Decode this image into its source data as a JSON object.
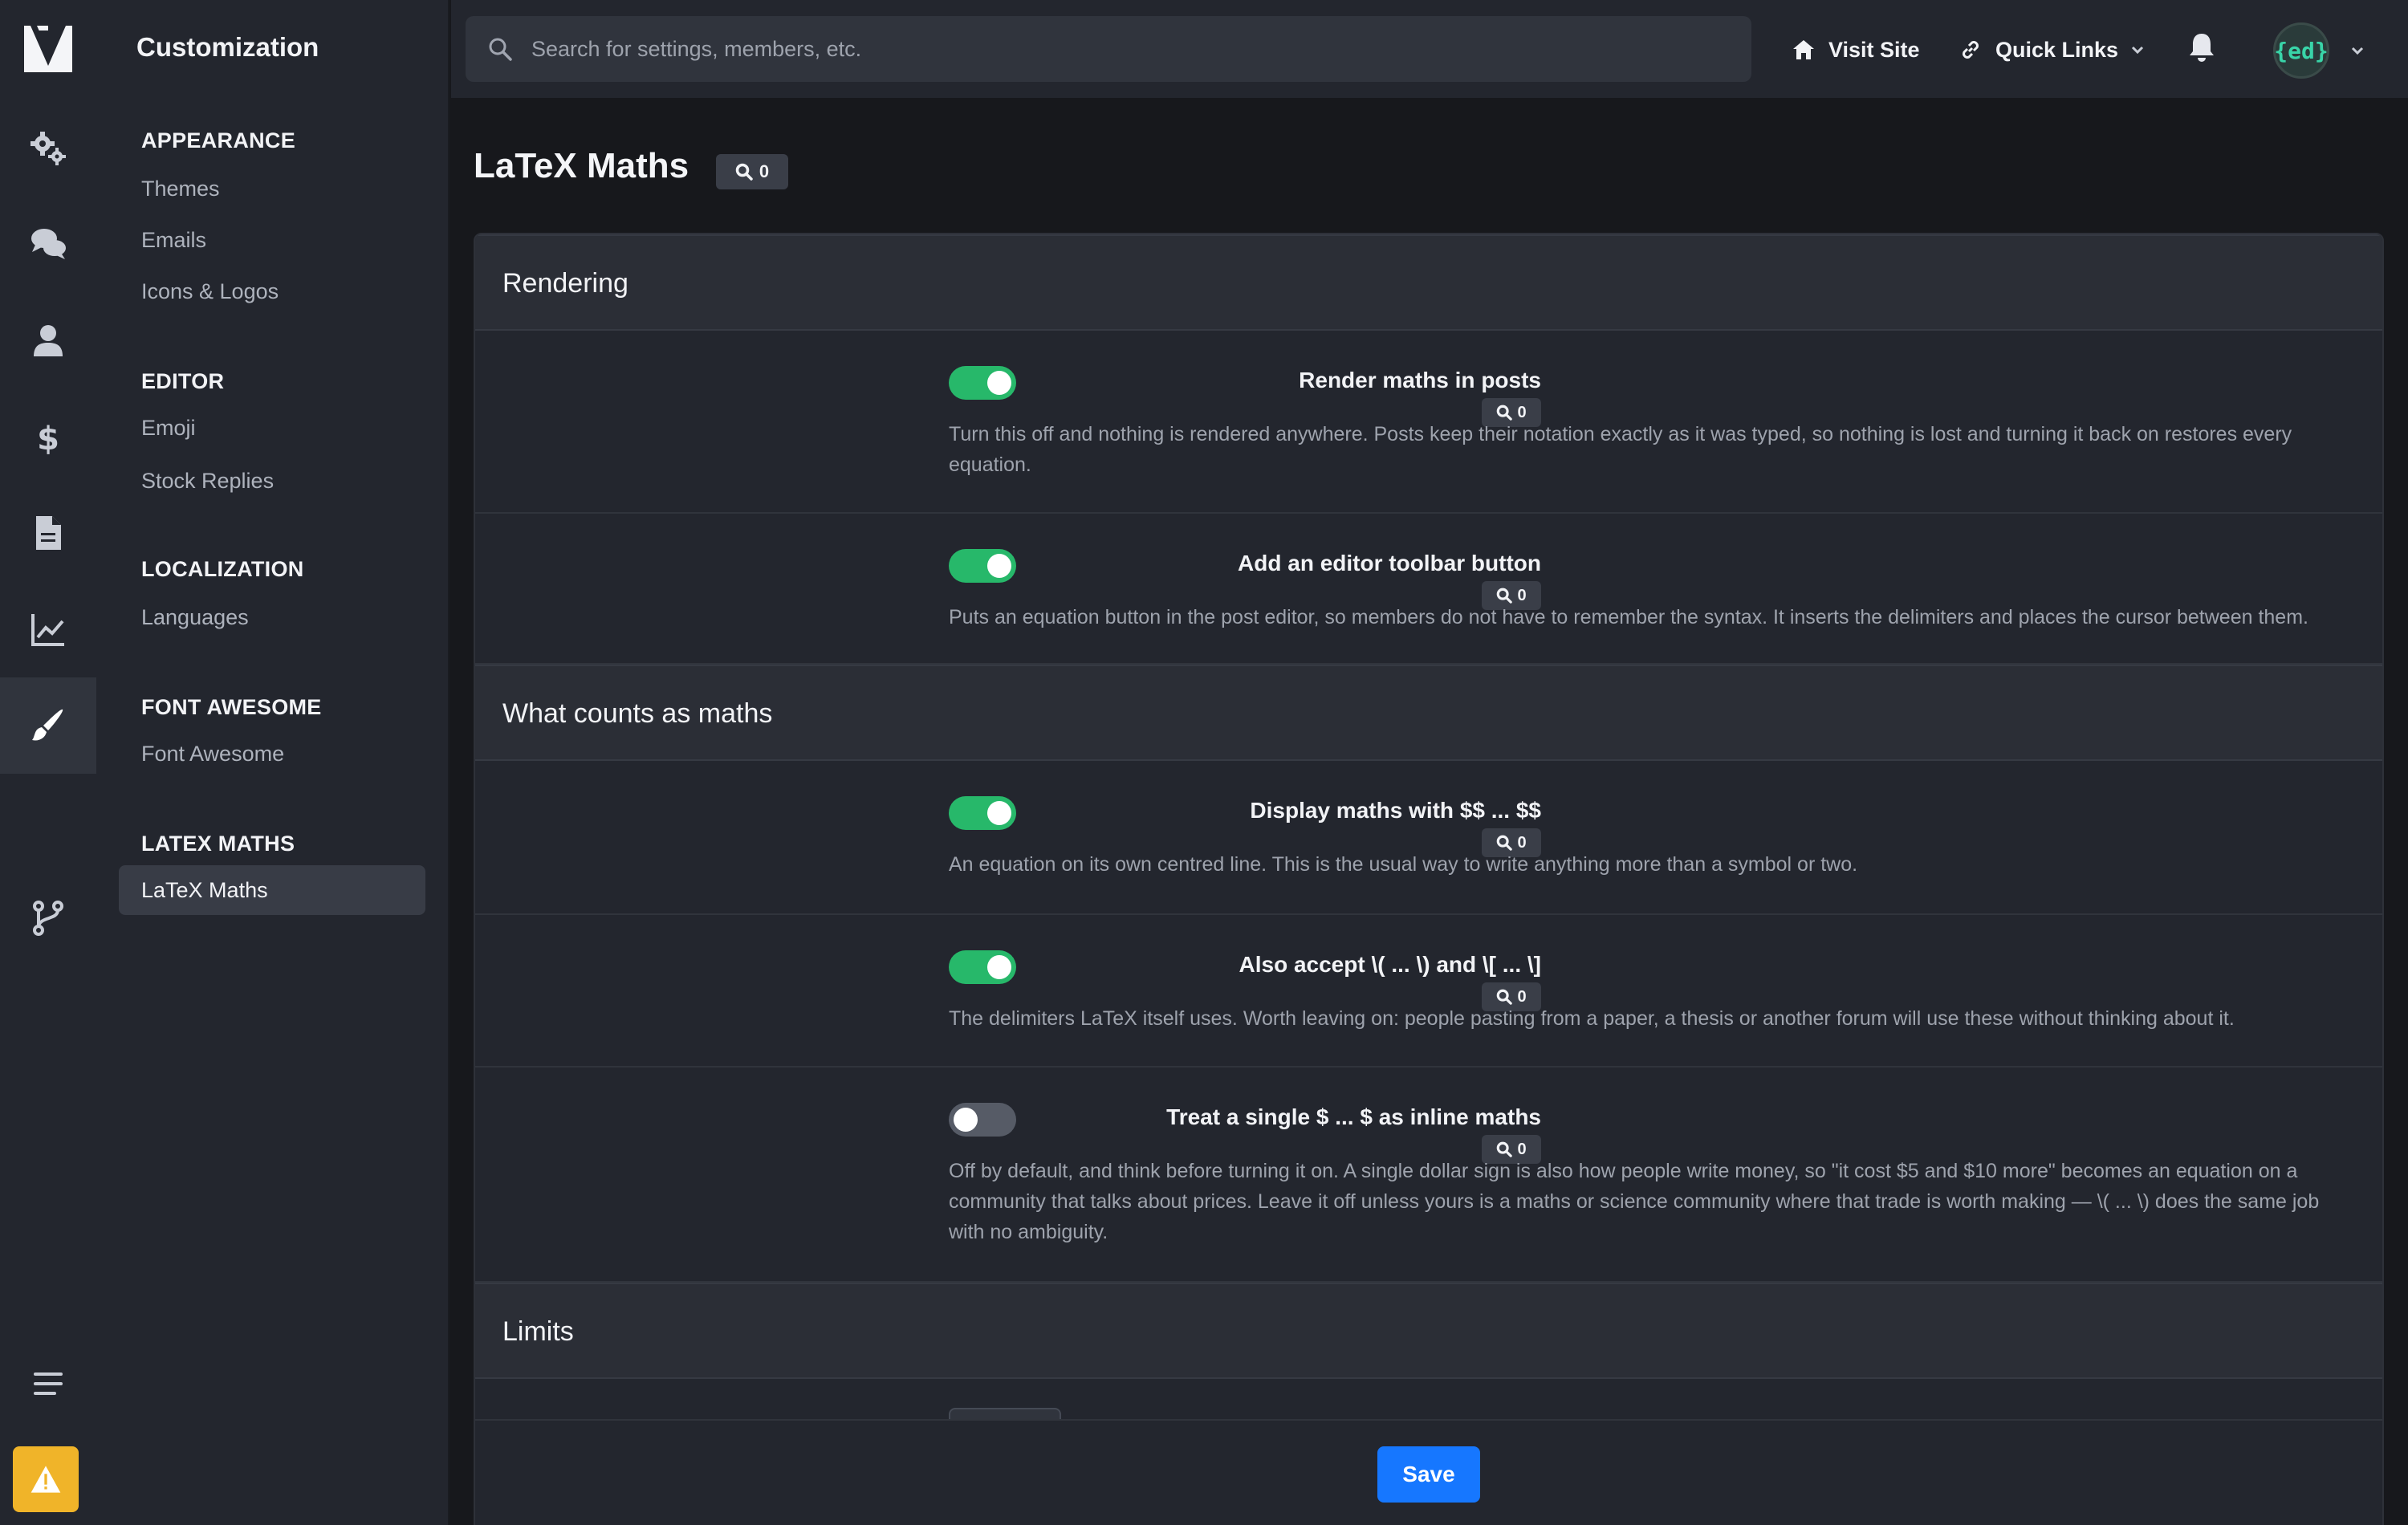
{
  "app": {
    "section_title": "Customization"
  },
  "rail": {
    "icons": [
      "logo-icon",
      "settings-gears-icon",
      "discussions-icon",
      "members-icon",
      "commerce-dollar-icon",
      "pages-document-icon",
      "statistics-chart-icon",
      "customization-brush-icon",
      "developer-branch-icon",
      "menu-icon",
      "warning-icon"
    ],
    "active": "customization-brush-icon",
    "warning_color": "#f0b429"
  },
  "subnav": {
    "groups": [
      {
        "title": "APPEARANCE",
        "items": [
          "Themes",
          "Emails",
          "Icons & Logos"
        ]
      },
      {
        "title": "EDITOR",
        "items": [
          "Emoji",
          "Stock Replies"
        ]
      },
      {
        "title": "LOCALIZATION",
        "items": [
          "Languages"
        ]
      },
      {
        "title": "FONT AWESOME",
        "items": [
          "Font Awesome"
        ]
      },
      {
        "title": "LATEX MATHS",
        "items": [
          "LaTeX Maths"
        ]
      }
    ],
    "active_item": "LaTeX Maths"
  },
  "topbar": {
    "search_placeholder": "Search for settings, members, etc.",
    "visit_site": "Visit Site",
    "quick_links": "Quick Links",
    "avatar_text": "{ed}"
  },
  "page": {
    "title": "LaTeX Maths",
    "search_count": "0"
  },
  "sections": [
    {
      "title": "Rendering",
      "rows": [
        {
          "label": "Render maths in posts",
          "count": "0",
          "enabled": true,
          "description": "Turn this off and nothing is rendered anywhere. Posts keep their notation exactly as it was typed, so nothing is lost and turning it back on restores every equation."
        },
        {
          "label": "Add an editor toolbar button",
          "count": "0",
          "enabled": true,
          "description": "Puts an equation button in the post editor, so members do not have to remember the syntax. It inserts the delimiters and places the cursor between them."
        }
      ]
    },
    {
      "title": "What counts as maths",
      "rows": [
        {
          "label": "Display maths with $$ ... $$",
          "count": "0",
          "enabled": true,
          "description": "An equation on its own centred line. This is the usual way to write anything more than a symbol or two."
        },
        {
          "label": "Also accept \\( ... \\) and \\[ ... \\]",
          "count": "0",
          "enabled": true,
          "description": "The delimiters LaTeX itself uses. Worth leaving on: people pasting from a paper, a thesis or another forum will use these without thinking about it."
        },
        {
          "label": "Treat a single $ ... $ as inline maths",
          "count": "0",
          "enabled": false,
          "description": "Off by default, and think before turning it on. A single dollar sign is also how people write money, so \"it cost $5 and $10 more\" becomes an equation on a community that talks about prices. Leave it off unless yours is a maths or science community where that trade is worth making — \\( ... \\) does the same job with no ambiguity."
        }
      ]
    },
    {
      "title": "Limits",
      "rows": []
    }
  ],
  "footer": {
    "save_label": "Save",
    "accent": "#1677ff"
  },
  "colors": {
    "toggle_on": "#27b86a",
    "toggle_off": "#565b66"
  }
}
